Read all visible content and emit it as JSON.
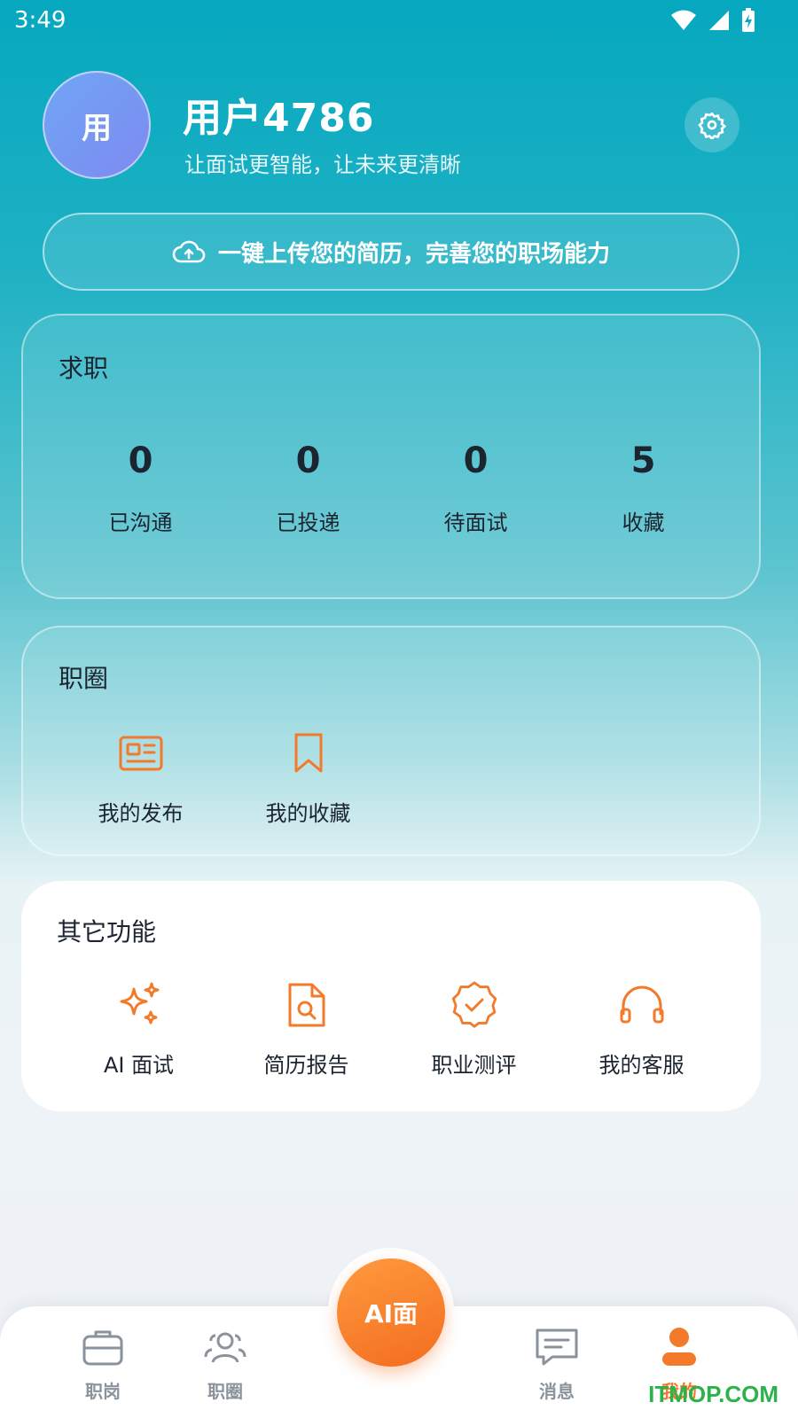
{
  "status_bar": {
    "time": "3:49"
  },
  "profile": {
    "avatar_text": "用",
    "username": "用户4786",
    "slogan": "让面试更智能，让未来更清晰"
  },
  "upload_banner": {
    "label": "一键上传您的简历，完善您的职场能力"
  },
  "job_card": {
    "title": "求职",
    "stats": [
      {
        "value": "0",
        "label": "已沟通"
      },
      {
        "value": "0",
        "label": "已投递"
      },
      {
        "value": "0",
        "label": "待面试"
      },
      {
        "value": "5",
        "label": "收藏"
      }
    ]
  },
  "circle_card": {
    "title": "职圈",
    "items": [
      {
        "label": "我的发布",
        "icon": "news-card-icon"
      },
      {
        "label": "我的收藏",
        "icon": "bookmark-icon"
      }
    ]
  },
  "other_card": {
    "title": "其它功能",
    "items": [
      {
        "label": "AI 面试",
        "icon": "sparkle-icon"
      },
      {
        "label": "简历报告",
        "icon": "document-search-icon"
      },
      {
        "label": "职业测评",
        "icon": "check-badge-icon"
      },
      {
        "label": "我的客服",
        "icon": "headset-icon"
      }
    ]
  },
  "tabbar": {
    "tabs": [
      {
        "label": "职岗",
        "icon": "briefcase-icon"
      },
      {
        "label": "职圈",
        "icon": "people-icon"
      },
      {
        "label": "消息",
        "icon": "chat-icon"
      },
      {
        "label": "我的",
        "icon": "user-icon",
        "active": true
      }
    ],
    "center_button": "AI面"
  },
  "watermark": "ITMOP.COM",
  "colors": {
    "accent": "#f27a2a",
    "header_teal": "#06a8bf",
    "text": "#1c2430"
  }
}
